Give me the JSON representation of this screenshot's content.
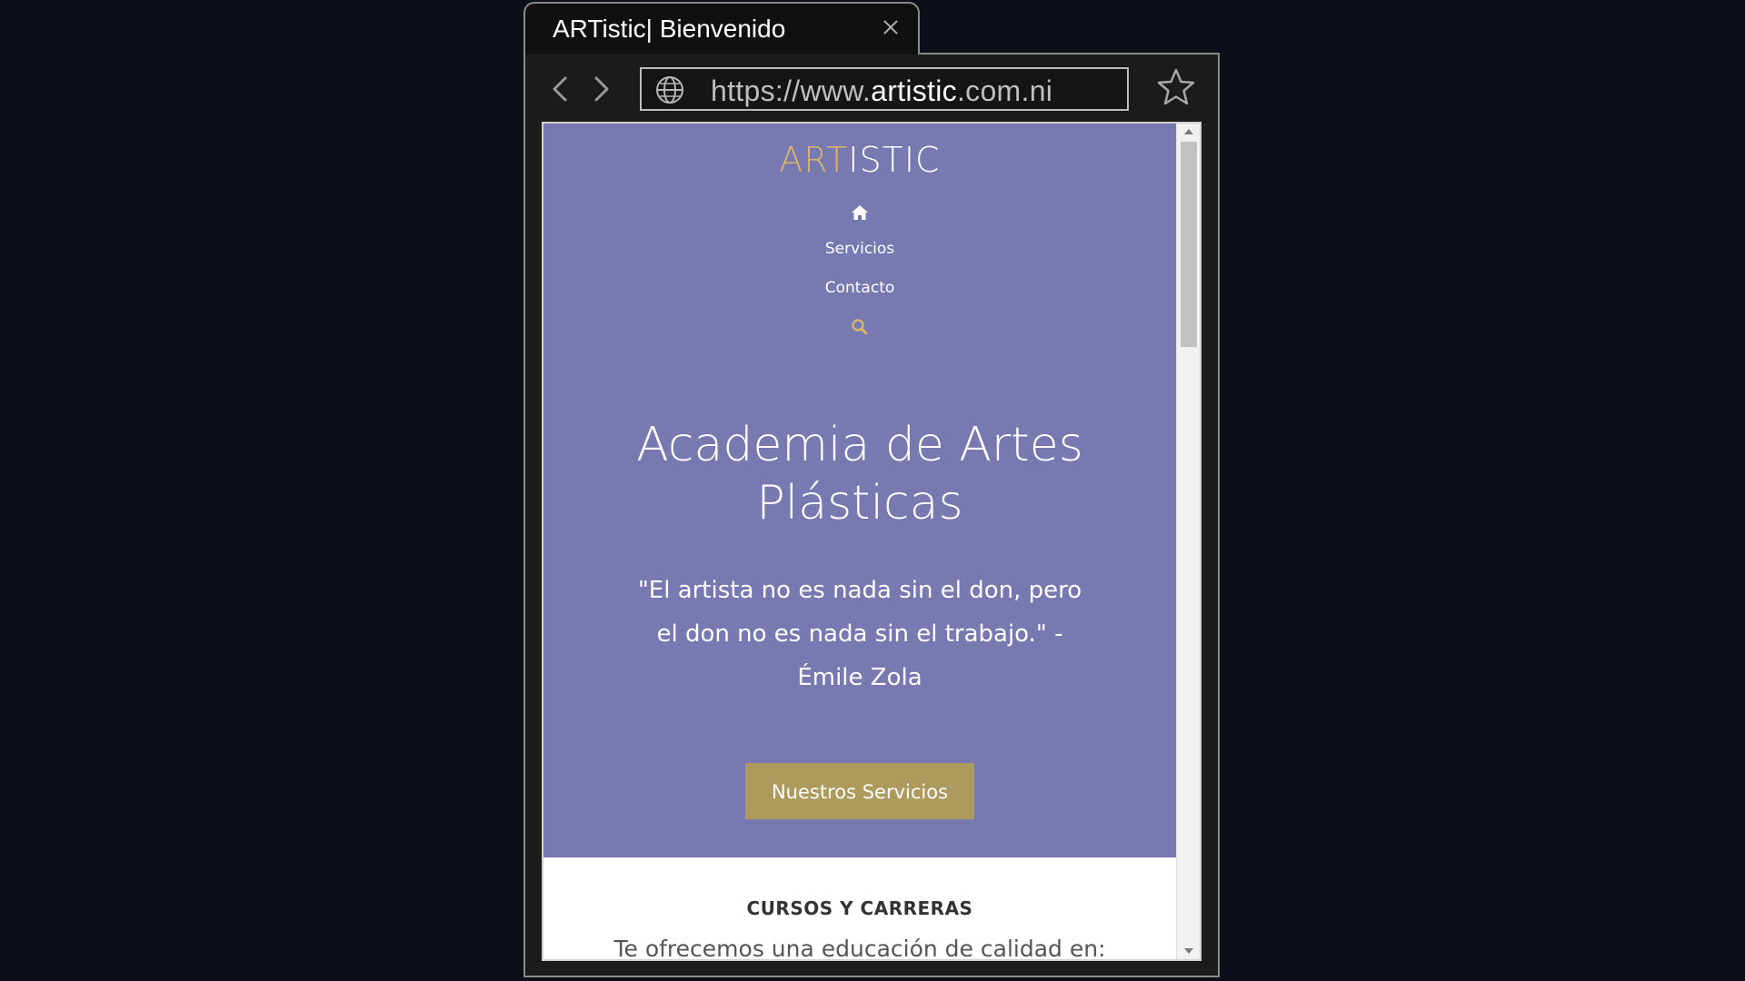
{
  "tab": {
    "title": "ARTistic| Bienvenido",
    "close_icon": "close-icon"
  },
  "toolbar": {
    "back_icon": "chevron-left-icon",
    "forward_icon": "chevron-right-icon",
    "url_prefix": "https://www.",
    "url_domain": "artistic",
    "url_suffix": ".com.ni",
    "site_icon": "globe-icon",
    "bookmark_icon": "star-icon"
  },
  "site": {
    "logo_accent": "ART",
    "logo_rest": "ISTIC",
    "nav": {
      "home_icon": "home-icon",
      "items": [
        "Servicios",
        "Contacto"
      ],
      "search_icon": "search-icon"
    },
    "hero": {
      "title_line1": "Academia de Artes",
      "title_line2": "Plásticas",
      "quote_line1": "\"El artista no es nada sin el don, pero",
      "quote_line2": "el don no es nada sin el trabajo.\" -",
      "quote_line3": "Émile Zola",
      "cta_label": "Nuestros Servicios"
    },
    "section": {
      "title": "CURSOS Y CARRERAS",
      "subtitle": "Te ofrecemos una educación de calidad en:"
    }
  },
  "colors": {
    "hero_bg": "#7779b0",
    "accent_gold": "#d8b56a",
    "cta_bg": "#ad9a5d",
    "page_bg": "#0a0f1a"
  }
}
